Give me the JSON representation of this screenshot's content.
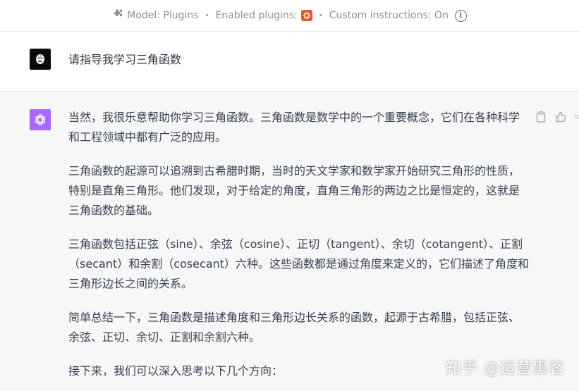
{
  "topbar": {
    "model_label": "Model: Plugins",
    "plugins_label": "Enabled plugins:",
    "instructions_label": "Custom instructions: On",
    "separator": "•"
  },
  "user_message": {
    "text": "请指导我学习三角函数"
  },
  "assistant_message": {
    "paragraphs": [
      "当然，我很乐意帮助你学习三角函数。三角函数是数学中的一个重要概念，它们在各种科学和工程领域中都有广泛的应用。",
      "三角函数的起源可以追溯到古希腊时期，当时的天文学家和数学家开始研究三角形的性质，特别是直角三角形。他们发现，对于给定的角度，直角三角形的两边之比是恒定的，这就是三角函数的基础。",
      "三角函数包括正弦（sine）、余弦（cosine）、正切（tangent）、余切（cotangent）、正割（secant）和余割（cosecant）六种。这些函数都是通过角度来定义的，它们描述了角度和三角形边长之间的关系。",
      "简单总结一下，三角函数是描述角度和三角形边长关系的函数，起源于古希腊，包括正弦、余弦、正切、余切、正割和余割六种。",
      "接下来，我们可以深入思考以下几个方向："
    ]
  },
  "watermark": "知乎 @运营黑客",
  "icons": {
    "plugins": "puzzle-icon",
    "plugin_badge": "plugin-logo-icon",
    "info": "info-icon",
    "copy": "clipboard-icon",
    "like": "thumbs-up-icon",
    "dislike": "thumbs-down-icon"
  },
  "colors": {
    "assistant_bg": "#f7f7f8",
    "gpt_avatar": "#ab68ff",
    "text": "#374151",
    "muted": "#8e8ea0"
  }
}
